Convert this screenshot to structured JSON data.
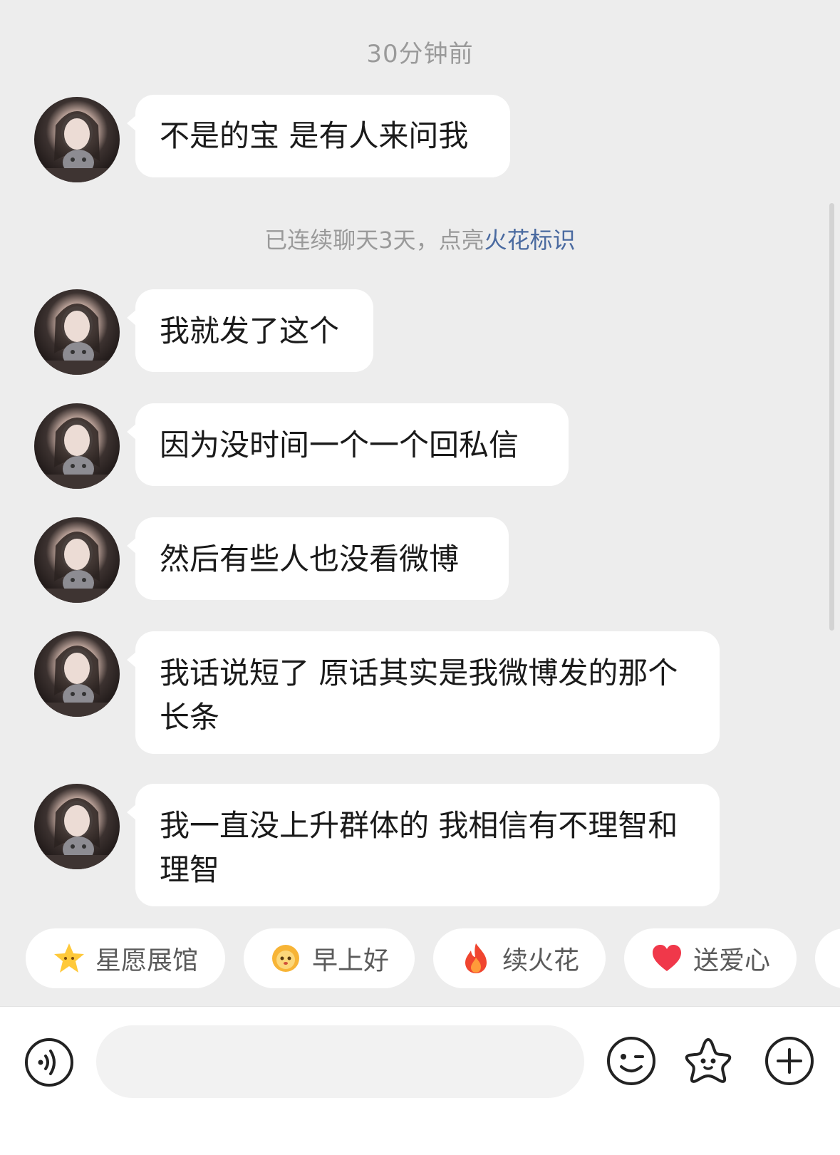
{
  "chat": {
    "timestamp": "30分钟前",
    "system_note_prefix": "已连续聊天3天，点亮",
    "system_note_link": "火花标识",
    "messages": [
      {
        "text": "不是的宝 是有人来问我"
      },
      {
        "text": "我就发了这个"
      },
      {
        "text": "因为没时间一个一个回私信"
      },
      {
        "text": "然后有些人也没看微博"
      },
      {
        "text": "我话说短了 原话其实是我微博发的那个长条"
      },
      {
        "text": "我一直没上升群体的 我相信有不理智和理智"
      }
    ]
  },
  "quick_replies": [
    {
      "label": "星愿展馆",
      "icon": "star-face-icon"
    },
    {
      "label": "早上好",
      "icon": "sun-face-icon"
    },
    {
      "label": "续火花",
      "icon": "flame-icon"
    },
    {
      "label": "送爱心",
      "icon": "heart-icon"
    }
  ],
  "input": {
    "value": "",
    "placeholder": ""
  },
  "toolbar": {
    "voice_icon": "voice-icon",
    "emoji_icon": "emoji-icon",
    "sticker_icon": "sticker-star-icon",
    "more_icon": "plus-icon"
  },
  "colors": {
    "background": "#ededed",
    "bubble": "#ffffff",
    "link": "#4a6aa0",
    "muted_text": "#9a9a9a"
  }
}
